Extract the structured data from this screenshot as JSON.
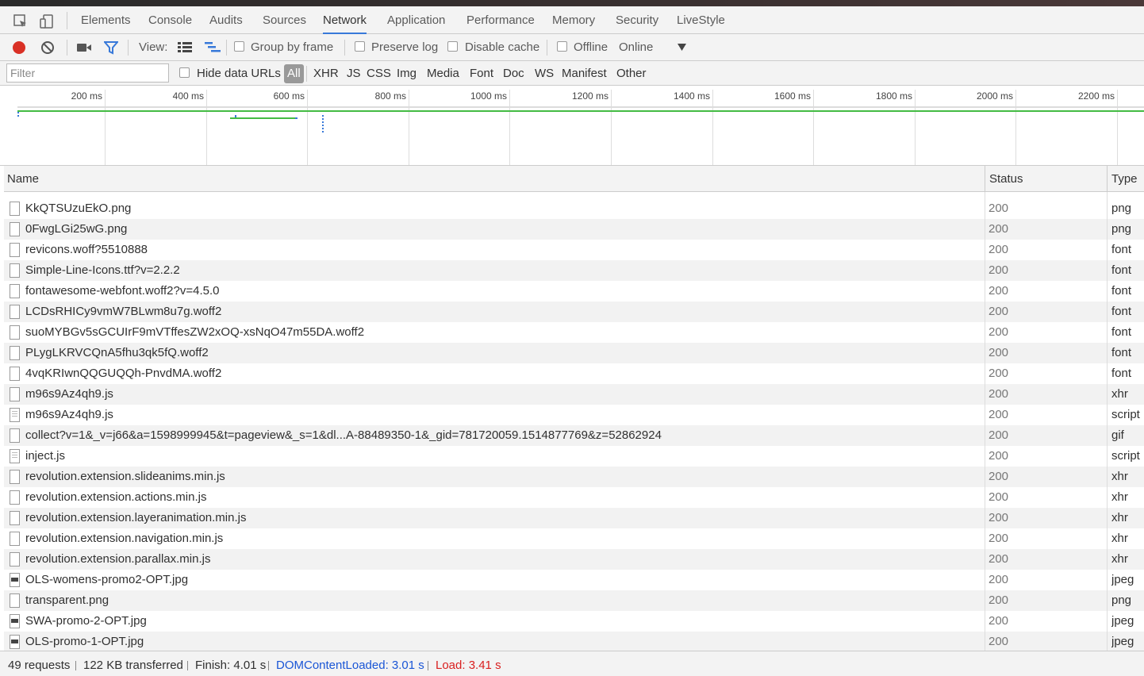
{
  "panel_tabs": [
    "Elements",
    "Console",
    "Audits",
    "Sources",
    "Network",
    "Application",
    "Performance",
    "Memory",
    "Security",
    "LiveStyle"
  ],
  "active_tab": "Network",
  "toolbar": {
    "view_label": "View:",
    "group_by_frame": "Group by frame",
    "preserve_log": "Preserve log",
    "disable_cache": "Disable cache",
    "offline": "Offline",
    "throttle_value": "Online"
  },
  "filterbar": {
    "placeholder": "Filter",
    "hide_data_urls": "Hide data URLs",
    "types": [
      "All",
      "XHR",
      "JS",
      "CSS",
      "Img",
      "Media",
      "Font",
      "Doc",
      "WS",
      "Manifest",
      "Other"
    ],
    "active_type": "All"
  },
  "overview": {
    "ticks": [
      "200 ms",
      "400 ms",
      "600 ms",
      "800 ms",
      "1000 ms",
      "1200 ms",
      "1400 ms",
      "1600 ms",
      "1800 ms",
      "2000 ms",
      "2200 ms"
    ]
  },
  "table": {
    "headers": {
      "name": "Name",
      "status": "Status",
      "type": "Type"
    },
    "rows": [
      {
        "name": "KkQTSUzuEkO.png",
        "status": "200",
        "type": "png",
        "icon": "doc"
      },
      {
        "name": "0FwgLGi25wG.png",
        "status": "200",
        "type": "png",
        "icon": "doc"
      },
      {
        "name": "revicons.woff?5510888",
        "status": "200",
        "type": "font",
        "icon": "doc"
      },
      {
        "name": "Simple-Line-Icons.ttf?v=2.2.2",
        "status": "200",
        "type": "font",
        "icon": "doc"
      },
      {
        "name": "fontawesome-webfont.woff2?v=4.5.0",
        "status": "200",
        "type": "font",
        "icon": "doc"
      },
      {
        "name": "LCDsRHICy9vmW7BLwm8u7g.woff2",
        "status": "200",
        "type": "font",
        "icon": "doc"
      },
      {
        "name": "suoMYBGv5sGCUIrF9mVTffesZW2xOQ-xsNqO47m55DA.woff2",
        "status": "200",
        "type": "font",
        "icon": "doc"
      },
      {
        "name": "PLygLKRVCQnA5fhu3qk5fQ.woff2",
        "status": "200",
        "type": "font",
        "icon": "doc"
      },
      {
        "name": "4vqKRIwnQQGUQQh-PnvdMA.woff2",
        "status": "200",
        "type": "font",
        "icon": "doc"
      },
      {
        "name": "m96s9Az4qh9.js",
        "status": "200",
        "type": "xhr",
        "icon": "doc"
      },
      {
        "name": "m96s9Az4qh9.js",
        "status": "200",
        "type": "script",
        "icon": "script"
      },
      {
        "name": "collect?v=1&_v=j66&a=1598999945&t=pageview&_s=1&dl...A-88489350-1&_gid=781720059.1514877769&z=52862924",
        "status": "200",
        "type": "gif",
        "icon": "doc"
      },
      {
        "name": "inject.js",
        "status": "200",
        "type": "script",
        "icon": "script"
      },
      {
        "name": "revolution.extension.slideanims.min.js",
        "status": "200",
        "type": "xhr",
        "icon": "doc"
      },
      {
        "name": "revolution.extension.actions.min.js",
        "status": "200",
        "type": "xhr",
        "icon": "doc"
      },
      {
        "name": "revolution.extension.layeranimation.min.js",
        "status": "200",
        "type": "xhr",
        "icon": "doc"
      },
      {
        "name": "revolution.extension.navigation.min.js",
        "status": "200",
        "type": "xhr",
        "icon": "doc"
      },
      {
        "name": "revolution.extension.parallax.min.js",
        "status": "200",
        "type": "xhr",
        "icon": "doc"
      },
      {
        "name": "OLS-womens-promo2-OPT.jpg",
        "status": "200",
        "type": "jpeg",
        "icon": "image"
      },
      {
        "name": "transparent.png",
        "status": "200",
        "type": "png",
        "icon": "doc"
      },
      {
        "name": "SWA-promo-2-OPT.jpg",
        "status": "200",
        "type": "jpeg",
        "icon": "image"
      },
      {
        "name": "OLS-promo-1-OPT.jpg",
        "status": "200",
        "type": "jpeg",
        "icon": "image"
      }
    ]
  },
  "statusbar": {
    "requests": "49 requests",
    "transferred": "122 KB transferred",
    "finish": "Finish: 4.01 s",
    "domcontentloaded": "DOMContentLoaded: 3.01 s",
    "load": "Load: 3.41 s"
  },
  "colors": {
    "record": "#d93025",
    "accent": "#3879d9",
    "domcontentloaded": "#1a56d6",
    "load": "#d92020",
    "timeline_green": "#44bb44"
  }
}
